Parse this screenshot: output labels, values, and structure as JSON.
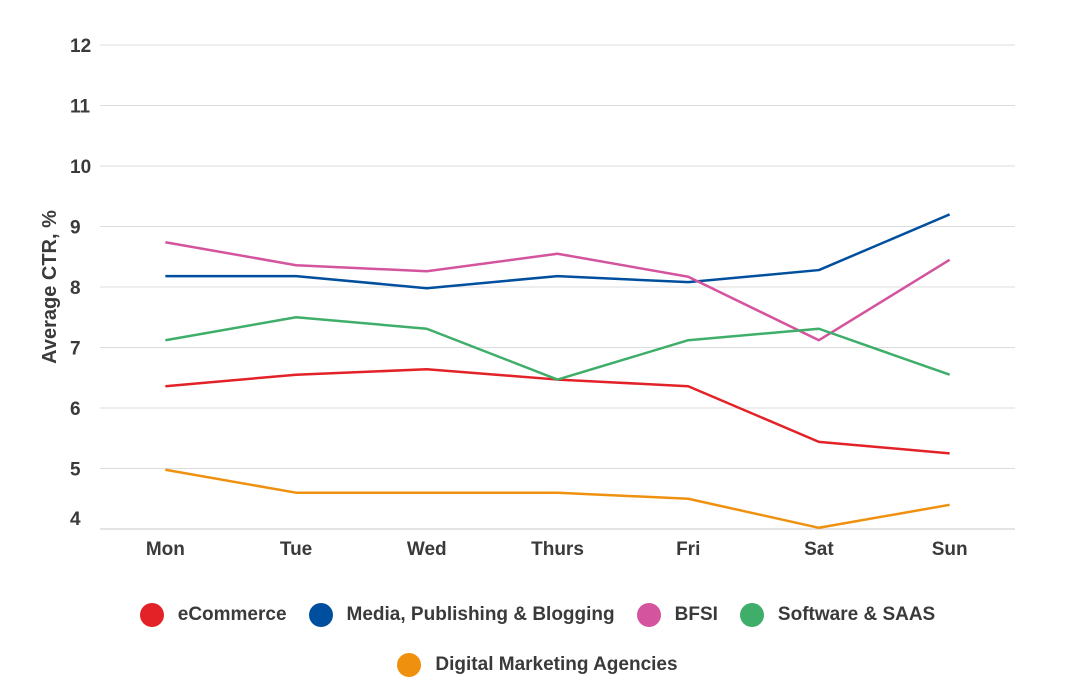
{
  "chart_data": {
    "type": "line",
    "title": "",
    "xlabel": "",
    "ylabel": "Average CTR, %",
    "categories": [
      "Mon",
      "Tue",
      "Wed",
      "Thurs",
      "Fri",
      "Sat",
      "Sun"
    ],
    "ylim": [
      4,
      12
    ],
    "yticks": [
      4,
      5,
      6,
      7,
      8,
      9,
      10,
      11,
      12
    ],
    "grid": true,
    "legend_position": "bottom",
    "series": [
      {
        "name": "eCommerce",
        "color": "#e32227",
        "values": [
          6.36,
          6.55,
          6.64,
          6.47,
          6.36,
          5.44,
          5.25
        ]
      },
      {
        "name": "Media, Publishing & Blogging",
        "color": "#004f9f",
        "values": [
          8.18,
          8.18,
          7.98,
          8.18,
          8.08,
          8.28,
          9.2
        ]
      },
      {
        "name": "BFSI",
        "color": "#d4549e",
        "values": [
          8.74,
          8.36,
          8.26,
          8.55,
          8.17,
          7.12,
          8.45
        ]
      },
      {
        "name": "Software & SAAS",
        "color": "#3fae6a",
        "values": [
          7.12,
          7.5,
          7.31,
          6.47,
          7.12,
          7.31,
          6.55
        ]
      },
      {
        "name": "Digital Marketing Agencies",
        "color": "#f0900f",
        "values": [
          4.98,
          4.6,
          4.6,
          4.6,
          4.5,
          4.02,
          4.4
        ]
      }
    ]
  }
}
